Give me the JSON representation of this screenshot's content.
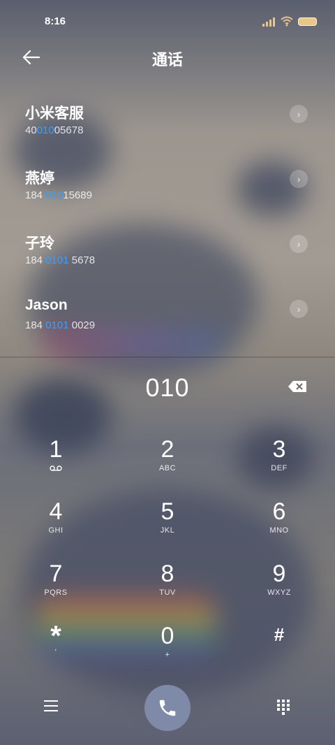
{
  "status": {
    "time": "8:16"
  },
  "header": {
    "title": "通话"
  },
  "contacts": [
    {
      "name": "小米客服",
      "pre": "40",
      "hl": "010",
      "post": "05678"
    },
    {
      "name": "燕婷",
      "pre": "184 ",
      "hl": "010",
      "post": "15689"
    },
    {
      "name": "子玲",
      "pre": "184 ",
      "hl": "0101",
      "post": " 5678"
    },
    {
      "name": "Jason",
      "pre": "184 ",
      "hl": "0101",
      "post": " 0029"
    }
  ],
  "dialer": {
    "input": "010",
    "keys": [
      {
        "digit": "1",
        "letters": ""
      },
      {
        "digit": "2",
        "letters": "ABC"
      },
      {
        "digit": "3",
        "letters": "DEF"
      },
      {
        "digit": "4",
        "letters": "GHI"
      },
      {
        "digit": "5",
        "letters": "JKL"
      },
      {
        "digit": "6",
        "letters": "MNO"
      },
      {
        "digit": "7",
        "letters": "PQRS"
      },
      {
        "digit": "8",
        "letters": "TUV"
      },
      {
        "digit": "9",
        "letters": "WXYZ"
      },
      {
        "digit": "*",
        "letters": ","
      },
      {
        "digit": "0",
        "letters": "+"
      },
      {
        "digit": "#",
        "letters": ""
      }
    ]
  },
  "icons": {
    "back": "back-arrow-icon",
    "chevron": "chevron-right-icon",
    "delete": "backspace-icon",
    "voicemail": "voicemail-icon",
    "menu": "hamburger-menu-icon",
    "call": "phone-call-icon",
    "dialpad": "dialpad-icon"
  },
  "colors": {
    "highlight": "#3aa0ff",
    "call_button": "#7e8aa8",
    "battery": "#e8c68a"
  }
}
